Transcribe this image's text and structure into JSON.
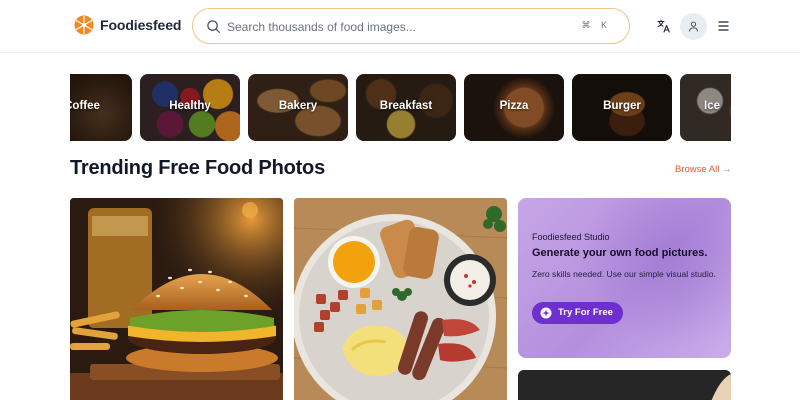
{
  "header": {
    "brand": "Foodiesfeed",
    "search_placeholder": "Search thousands of food images...",
    "search_shortcut": "⌘ K"
  },
  "categories": [
    "Coffee",
    "Healthy",
    "Bakery",
    "Breakfast",
    "Pizza",
    "Burger",
    "Ice"
  ],
  "section": {
    "title": "Trending Free Food Photos",
    "browse_all": "Browse All →"
  },
  "promo": {
    "eyebrow": "Foodiesfeed Studio",
    "title": "Generate your own food pictures.",
    "description": "Zero skills needed. Use our simple visual studio.",
    "cta": "Try For Free"
  },
  "colors": {
    "accent": "#e05a3a",
    "search_border": "#f1c48a",
    "promo_button": "#6d2fd0",
    "promo_bg": "#b48fde"
  },
  "icons": [
    "foodiesfeed-logo-icon",
    "search-icon",
    "translate-icon",
    "user-icon",
    "menu-icon",
    "sparkle-icon"
  ]
}
